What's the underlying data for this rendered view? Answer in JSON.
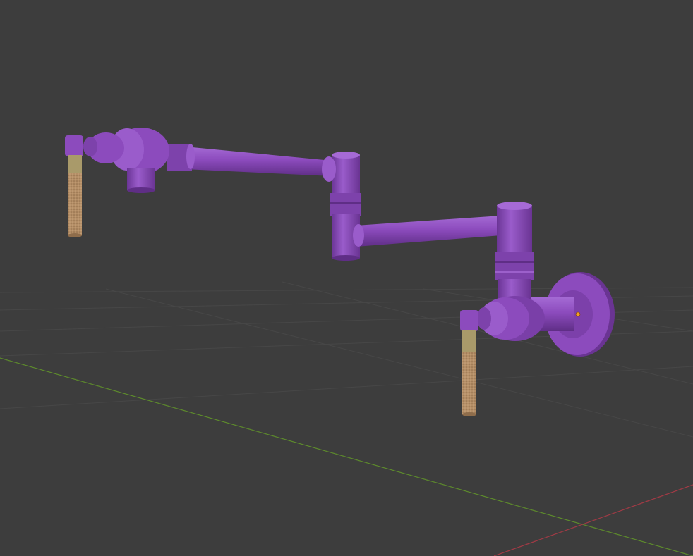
{
  "viewport": {
    "background": "#3d3d3d",
    "grid_color": "#474747",
    "x_axis_color": "#a03a45",
    "y_axis_color": "#5d8a2c",
    "origin_color": "#f0a028"
  },
  "object": {
    "material_color": "#8c4bbd",
    "material_light": "#a66ad6",
    "material_dark": "#6a3493",
    "handle_color": "#b48e66",
    "handle_collar_color": "#a99a6a"
  }
}
